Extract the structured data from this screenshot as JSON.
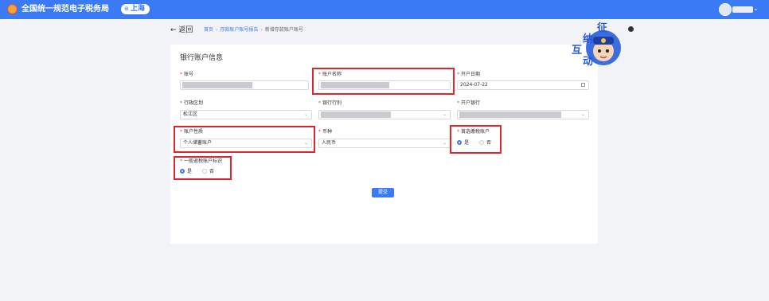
{
  "header": {
    "app_title": "全国统一规范电子税务局",
    "region": "上海"
  },
  "nav": {
    "back_label": "← 返回",
    "breadcrumb": [
      "首页",
      "存款账户账号报告",
      "新增存款账户账号"
    ]
  },
  "mascot": {
    "chars": [
      "征",
      "纳",
      "互",
      "动"
    ]
  },
  "form": {
    "title": "银行账户信息",
    "account_number": {
      "label": "账号"
    },
    "account_name": {
      "label": "账户名称"
    },
    "open_date": {
      "label": "开户日期",
      "value": "2024-07-22"
    },
    "district": {
      "label": "行政区划",
      "value": "松江区"
    },
    "bank_category": {
      "label": "银行行别"
    },
    "opening_bank": {
      "label": "开户银行"
    },
    "account_nature": {
      "label": "账户性质",
      "value": "个人储蓄账户"
    },
    "currency": {
      "label": "币种",
      "value": "人民币"
    },
    "preferred_tax_account": {
      "label": "首选缴税账户",
      "yes": "是",
      "no": "否",
      "selected": "是"
    },
    "general_refund_flag": {
      "label": "一般退税账户标识",
      "yes": "是",
      "no": "否",
      "selected": "是"
    },
    "submit_label": "提交"
  },
  "colors": {
    "brand_blue": "#3a7bf5",
    "highlight_red": "#e3242b",
    "required_mark": "#e0462f"
  }
}
